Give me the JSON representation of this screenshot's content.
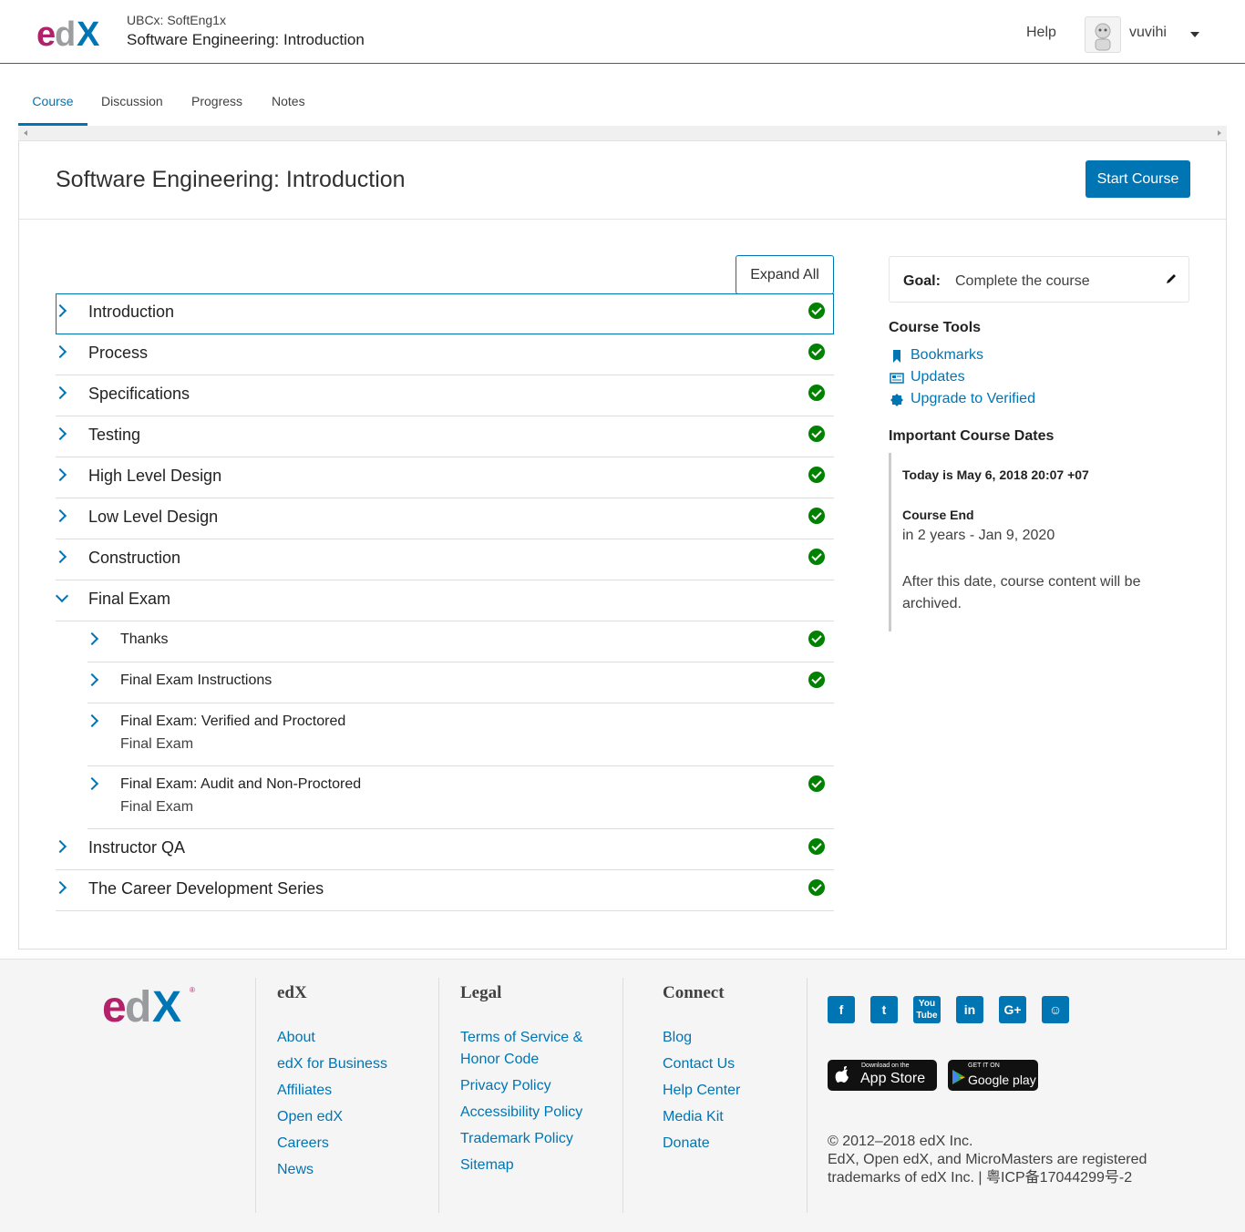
{
  "header": {
    "course_org": "UBCx: SoftEng1x",
    "course_title": "Software Engineering: Introduction",
    "help_label": "Help",
    "username": "vuvihi"
  },
  "tabs": [
    {
      "label": "Course",
      "active": true
    },
    {
      "label": "Discussion",
      "active": false
    },
    {
      "label": "Progress",
      "active": false
    },
    {
      "label": "Notes",
      "active": false
    }
  ],
  "page": {
    "title": "Software Engineering: Introduction",
    "start_button": "Start Course",
    "expand_button": "Expand All"
  },
  "outline": [
    {
      "label": "Introduction",
      "complete": true,
      "expanded": false
    },
    {
      "label": "Process",
      "complete": true,
      "expanded": false
    },
    {
      "label": "Specifications",
      "complete": true,
      "expanded": false
    },
    {
      "label": "Testing",
      "complete": true,
      "expanded": false
    },
    {
      "label": "High Level Design",
      "complete": true,
      "expanded": false
    },
    {
      "label": "Low Level Design",
      "complete": true,
      "expanded": false
    },
    {
      "label": "Construction",
      "complete": true,
      "expanded": false
    },
    {
      "label": "Final Exam",
      "complete": false,
      "expanded": true,
      "children": [
        {
          "label": "Thanks",
          "meta": "",
          "complete": true
        },
        {
          "label": "Final Exam Instructions",
          "meta": "",
          "complete": true
        },
        {
          "label": "Final Exam: Verified and Proctored",
          "meta": "Final Exam",
          "complete": false
        },
        {
          "label": "Final Exam: Audit and Non-Proctored",
          "meta": "Final Exam",
          "complete": true
        }
      ]
    },
    {
      "label": "Instructor QA",
      "complete": true,
      "expanded": false
    },
    {
      "label": "The Career Development Series",
      "complete": true,
      "expanded": false
    }
  ],
  "sidebar": {
    "goal_key": "Goal:",
    "goal_value": "Complete the course",
    "tools_heading": "Course Tools",
    "tools": [
      {
        "label": "Bookmarks",
        "icon": "bookmark-icon"
      },
      {
        "label": "Updates",
        "icon": "newspaper-icon"
      },
      {
        "label": "Upgrade to Verified",
        "icon": "certificate-icon"
      }
    ],
    "dates_heading": "Important Course Dates",
    "today": "Today is May 6, 2018 20:07 +07",
    "end_label": "Course End",
    "end_date": "in 2 years - Jan 9, 2020",
    "end_note": "After this date, course content will be archived."
  },
  "footer": {
    "edx_heading": "edX",
    "edx_links": [
      "About",
      "edX for Business",
      "Affiliates",
      "Open edX",
      "Careers",
      "News"
    ],
    "legal_heading": "Legal",
    "legal_links": [
      "Terms of Service &",
      "Honor Code",
      "Privacy Policy",
      "Accessibility Policy",
      "Trademark Policy",
      "Sitemap"
    ],
    "connect_heading": "Connect",
    "connect_links": [
      "Blog",
      "Contact Us",
      "Help Center",
      "Media Kit",
      "Donate"
    ],
    "social": [
      "facebook-icon",
      "twitter-icon",
      "youtube-icon",
      "linkedin-icon",
      "google-plus-icon",
      "reddit-icon"
    ],
    "app_store_small": "Download on the",
    "app_store_big": "App Store",
    "google_play_small": "GET IT ON",
    "google_play_big": "Google play",
    "copyright_1": "© 2012–2018 edX Inc.",
    "copyright_2": "EdX, Open edX, and MicroMasters are registered",
    "copyright_3": "trademarks of edX Inc. | 粤ICP备17044299号-2"
  },
  "colors": {
    "accent": "#0075b4",
    "complete": "#008100",
    "brand_magenta": "#b2226a",
    "brand_grey": "#8a8c8f"
  }
}
